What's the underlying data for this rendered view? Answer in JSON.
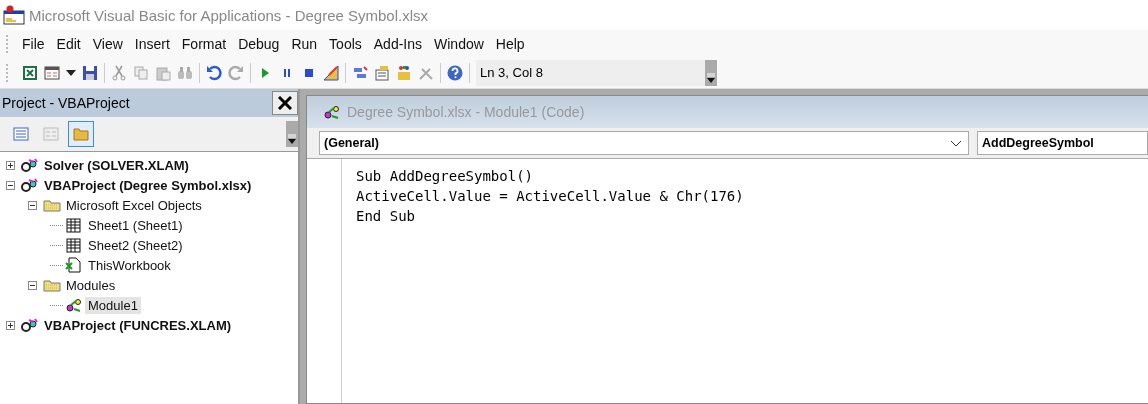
{
  "window": {
    "title": "Microsoft Visual Basic for Applications - Degree Symbol.xlsx"
  },
  "menu": [
    "File",
    "Edit",
    "View",
    "Insert",
    "Format",
    "Debug",
    "Run",
    "Tools",
    "Add-Ins",
    "Window",
    "Help"
  ],
  "toolbar": {
    "position": "Ln 3, Col 8"
  },
  "project_panel": {
    "title": "Project - VBAProject",
    "view_buttons": [
      {
        "kind": "view-code",
        "selected": false
      },
      {
        "kind": "view-object",
        "selected": false
      },
      {
        "kind": "toggle-folders",
        "selected": true
      }
    ],
    "tree": [
      {
        "label": "Solver (SOLVER.XLAM)",
        "kind": "project",
        "expanded": false,
        "selected": false
      },
      {
        "label": "VBAProject (Degree Symbol.xlsx)",
        "kind": "project",
        "expanded": true,
        "selected": false,
        "children": [
          {
            "label": "Microsoft Excel Objects",
            "kind": "folder",
            "expanded": true,
            "selected": false,
            "children": [
              {
                "label": "Sheet1 (Sheet1)",
                "kind": "sheet",
                "selected": false
              },
              {
                "label": "Sheet2 (Sheet2)",
                "kind": "sheet",
                "selected": false
              },
              {
                "label": "ThisWorkbook",
                "kind": "workbook",
                "selected": false
              }
            ]
          },
          {
            "label": "Modules",
            "kind": "folder",
            "expanded": true,
            "selected": false,
            "children": [
              {
                "label": "Module1",
                "kind": "module",
                "selected": true
              }
            ]
          }
        ]
      },
      {
        "label": "VBAProject (FUNCRES.XLAM)",
        "kind": "project",
        "expanded": false,
        "selected": false
      }
    ]
  },
  "code_window": {
    "title": "Degree Symbol.xlsx - Module1 (Code)",
    "object_box": "(General)",
    "procedure_box": "AddDegreeSymbol",
    "lines": [
      "Sub AddDegreeSymbol()",
      "ActiveCell.Value = ActiveCell.Value & Chr(176)",
      "End Sub"
    ]
  }
}
